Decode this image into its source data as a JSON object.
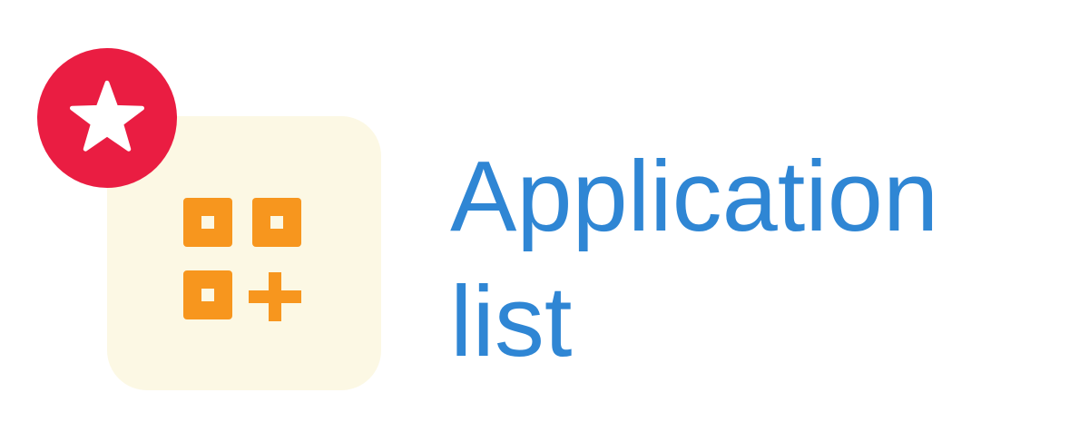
{
  "app_entry": {
    "label": "Application list",
    "icon": "apps-grid-add-icon",
    "badge_icon": "star-icon",
    "colors": {
      "label": "#2f86d4",
      "tile_background": "#fcf8e4",
      "icon": "#f7961e",
      "badge": "#ea1d42",
      "badge_star": "#ffffff"
    }
  }
}
